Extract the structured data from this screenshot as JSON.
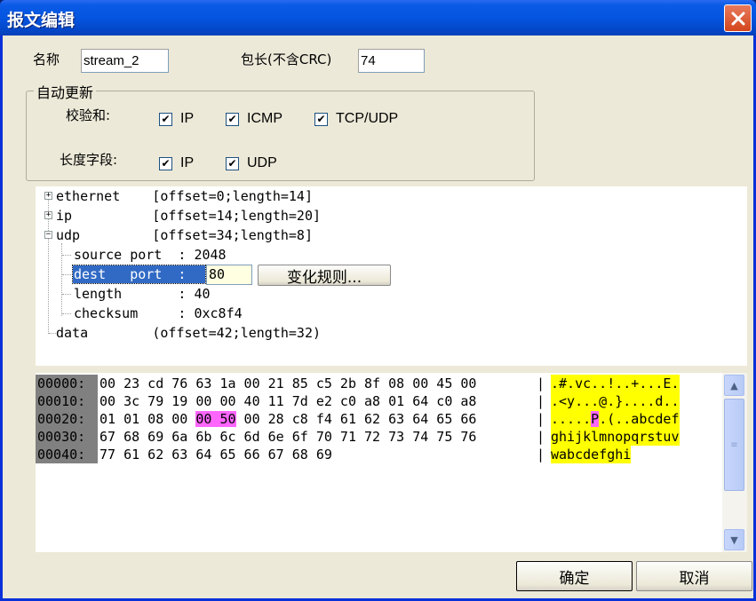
{
  "window": {
    "title": "报文编辑"
  },
  "form": {
    "name_label": "名称",
    "name_value": "stream_2",
    "length_label": "包长(不含CRC)",
    "length_value": "74"
  },
  "auto_update": {
    "title": "自动更新",
    "checksum_label": "校验和:",
    "checksum_options": [
      {
        "label": "IP",
        "checked": true
      },
      {
        "label": "ICMP",
        "checked": true
      },
      {
        "label": "TCP/UDP",
        "checked": true
      }
    ],
    "length_field_label": "长度字段:",
    "length_field_options": [
      {
        "label": "IP",
        "checked": true
      },
      {
        "label": "UDP",
        "checked": true
      }
    ],
    "check_glyph": "✔"
  },
  "tree": {
    "nodes": [
      {
        "text": "ethernet    [offset=0;length=14]",
        "expander": "+"
      },
      {
        "text": "ip          [offset=14;length=20]",
        "expander": "+"
      },
      {
        "text": "udp         [offset=34;length=8]",
        "expander": "−"
      },
      {
        "text": "source port  : 2048"
      },
      {
        "text": "dest   port  :"
      },
      {
        "text": "length       : 40"
      },
      {
        "text": "checksum     : 0xc8f4"
      },
      {
        "text": "data        (offset=42;length=32)"
      }
    ],
    "edit_value": "80",
    "rule_button": "变化规则..."
  },
  "hex": {
    "rows": [
      {
        "addr": "00000:",
        "pre": "00 23 cd 76 63 1a 00 21 85 c5 2b 8f 08 00 45 00",
        "hl": "",
        "post": "",
        "sep": "|",
        "ascii_pre": ".#.vc..!..+...E.",
        "ascii_hl": "",
        "ascii_post": ""
      },
      {
        "addr": "00010:",
        "pre": "00 3c 79 19 00 00 40 11 7d e2 c0 a8 01 64 c0 a8",
        "hl": "",
        "post": "",
        "sep": "|",
        "ascii_pre": ".<y...@.}....d..",
        "ascii_hl": "",
        "ascii_post": ""
      },
      {
        "addr": "00020:",
        "pre": "01 01 08 00 ",
        "hl": "00 50",
        "post": " 00 28 c8 f4 61 62 63 64 65 66",
        "sep": "|",
        "ascii_pre": ".....",
        "ascii_hl": "P",
        "ascii_post": ".(..abcdef"
      },
      {
        "addr": "00030:",
        "pre": "67 68 69 6a 6b 6c 6d 6e 6f 70 71 72 73 74 75 76",
        "hl": "",
        "post": "",
        "sep": "|",
        "ascii_pre": "ghijklmnopqrstuv",
        "ascii_hl": "",
        "ascii_post": ""
      },
      {
        "addr": "00040:",
        "pre": "77 61 62 63 64 65 66 67 68 69",
        "hl": "",
        "post": "",
        "sep": "|",
        "ascii_pre": "wabcdefghi",
        "ascii_hl": "",
        "ascii_post": ""
      }
    ]
  },
  "buttons": {
    "ok": "确定",
    "cancel": "取消"
  },
  "colors": {
    "highlight": "#ff66ff",
    "ascii_bg": "#ffff00",
    "selection": "#316ac5",
    "address_bg": "#808080"
  }
}
